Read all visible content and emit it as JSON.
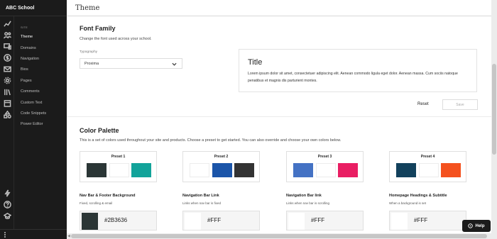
{
  "app": {
    "name": "ABC School"
  },
  "sidebar": {
    "section_label": "SITE",
    "items": [
      {
        "label": "Theme",
        "active": true
      },
      {
        "label": "Domains"
      },
      {
        "label": "Navigation"
      },
      {
        "label": "Bios"
      },
      {
        "label": "Pages"
      },
      {
        "label": "Comments"
      },
      {
        "label": "Custom Text"
      },
      {
        "label": "Code Snippets"
      },
      {
        "label": "Power Editor"
      }
    ]
  },
  "rail_icons": [
    "trend-icon",
    "users-icon",
    "devices-icon",
    "dollar-icon",
    "mail-icon",
    "gear-icon",
    "library-icon",
    "calendar-icon",
    "shapes-icon",
    "bolt-icon",
    "help-circle-icon",
    "graduation-icon"
  ],
  "page": {
    "title": "Theme"
  },
  "font_family": {
    "title": "Font Family",
    "description": "Change the font used across your school.",
    "typography_label": "Typography",
    "selected_font": "Proxima",
    "preview_title": "Title",
    "preview_body": "Lorem ipsum dolor sit amet, consectetuer adipiscing elit. Aenean commodo ligula eget dolor. Aenean massa. Cum sociis natoque penatibus et magnis dis parturient montes.",
    "reset_label": "Reset",
    "save_label": "Save"
  },
  "color_palette": {
    "title": "Color Palette",
    "description": "This is a set of colors used throughout your site and products. Choose a preset to get started. You can also override and choose your own colors below.",
    "presets": [
      {
        "name": "Preset 1",
        "colors": [
          "#2B3636",
          "#FFFFFF",
          "#12A39A"
        ]
      },
      {
        "name": "Preset 2",
        "colors": [
          "#FFFFFF",
          "#1B55A9",
          "#333333"
        ]
      },
      {
        "name": "Preset 3",
        "colors": [
          "#4472C4",
          "#FFFFFF",
          "#E91E63"
        ]
      },
      {
        "name": "Preset 4",
        "colors": [
          "#12415C",
          "#FFFFFF",
          "#F4511E"
        ]
      }
    ],
    "fields": [
      {
        "title": "Nav Bar & Footer Background",
        "subtitle": "Fixed, scrolling & email",
        "color": "#2B3636",
        "hex": "#2B3636"
      },
      {
        "title": "Navigation Bar Link",
        "subtitle": "Links when nav bar is fixed",
        "color": "#FFFFFF",
        "hex": "#FFF"
      },
      {
        "title": "Navigation Bar link",
        "subtitle": "Links when nav bar is scrolling",
        "color": "#FFFFFF",
        "hex": "#FFF"
      },
      {
        "title": "Homepage Headings & Subtitle",
        "subtitle": "When a background is set",
        "color": "#FFFFFF",
        "hex": "#FFF"
      }
    ]
  },
  "help": {
    "label": "Help"
  }
}
